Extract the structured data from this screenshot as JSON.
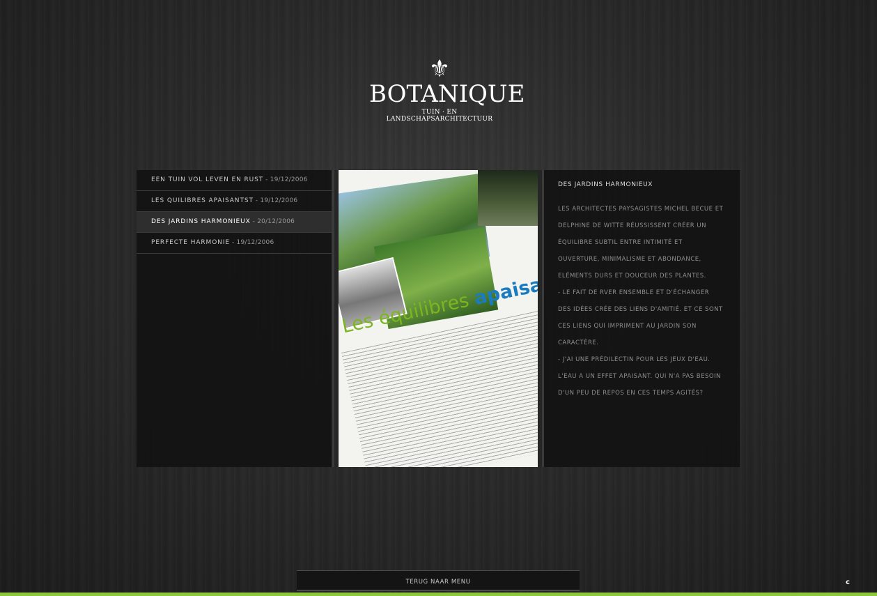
{
  "logo": {
    "symbol": "⚜",
    "name": "BOTANIQUE",
    "tagline": "TUIN · EN LANDSCHAPSARCHITECTUUR"
  },
  "menu": [
    {
      "title": "EEN TUIN VOL LEVEN EN RUST",
      "date": " - 19/12/2006",
      "active": false
    },
    {
      "title": "LES QUILIBRES APAISANTST",
      "date": " - 19/12/2006",
      "active": false
    },
    {
      "title": "DES JARDINS HARMONIEUX",
      "date": " - 20/12/2006",
      "active": true
    },
    {
      "title": "PERFECTE HARMONIE",
      "date": " - 19/12/2006",
      "active": false
    }
  ],
  "magazine": {
    "headline_light": "Les équilibres ",
    "headline_bold": "apaisants"
  },
  "article": {
    "title": "DES JARDINS HARMONIEUX",
    "paragraphs": [
      "LES ARCHITECTES PAYSAGISTES MICHEL BECUE ET DELPHINE DE WITTE RÉUSSISSENT  CRÉER UN ÉQUILIBRE SUBTIL ENTRE INTIMITÉ ET OUVERTURE, MINIMALISME ET ABONDANCE, ELÉMENTS DURS ET DOUCEUR DES PLANTES.",
      "- LE FAIT DE RVER ENSEMBLE ET D'ÉCHANGER DES IDÉES CRÉE DES LIENS D'AMITIÉ. ET CE SONT CES LIENS QUI IMPRIMENT AU JARDIN SON CARACTÈRE.",
      "- J'AI UNE PRÉDILECTIN POUR LES JEUX D'EAU. L'EAU A UN EFFET APAISANT. QUI N'A PAS BESOIN D'UN PEU DE REPOS EN CES TEMPS AGITÉS?"
    ]
  },
  "footer": {
    "back_label": "TERUG NAAR MENU",
    "credit_glyph": "c",
    "accent": "#8ec63f"
  }
}
